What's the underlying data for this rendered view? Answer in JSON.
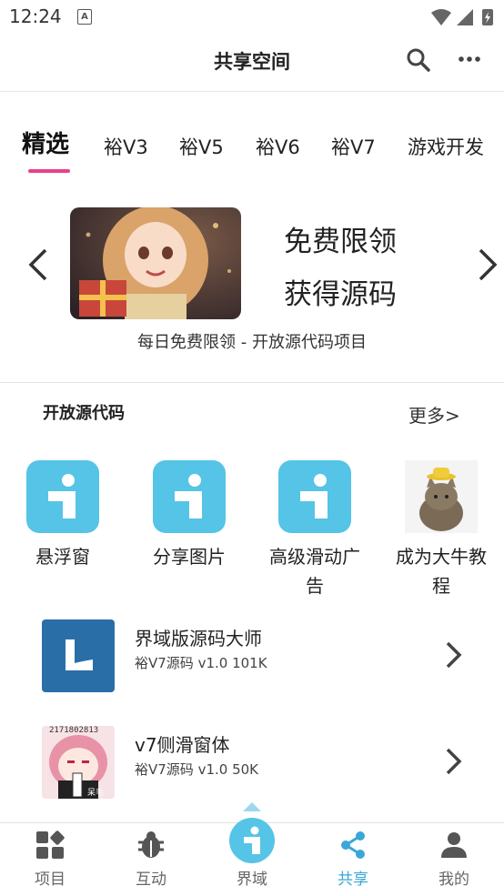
{
  "status_bar": {
    "time": "12:24",
    "notif_glyph": "A"
  },
  "header": {
    "title": "共享空间",
    "search_icon": "search-icon",
    "more_icon": "more-icon"
  },
  "tabs": [
    {
      "label": "精选",
      "active": true
    },
    {
      "label": "裕V3"
    },
    {
      "label": "裕V5"
    },
    {
      "label": "裕V6"
    },
    {
      "label": "裕V7"
    },
    {
      "label": "游戏开发"
    }
  ],
  "banner": {
    "line1": "免费限领",
    "line2": "获得源码",
    "caption": "每日免费限领 - 开放源代码项目"
  },
  "section": {
    "title": "开放源代码",
    "more": "更多>"
  },
  "grid": [
    {
      "label": "悬浮窗",
      "icon": "info-app-icon"
    },
    {
      "label": "分享图片",
      "icon": "info-app-icon"
    },
    {
      "label": "高级滑动广告",
      "icon": "info-app-icon"
    },
    {
      "label": "成为大牛教程",
      "icon": "cat-hat-image"
    }
  ],
  "list": [
    {
      "title": "界域版源码大师",
      "meta": "裕V7源码  v1.0  101K"
    },
    {
      "title": "v7侧滑窗体",
      "meta": "裕V7源码  v1.0  50K",
      "thumb_text": "2171802813",
      "thumb_tag": "呆毛"
    }
  ],
  "bottom_nav": [
    {
      "label": "项目",
      "icon": "grid-icon"
    },
    {
      "label": "互动",
      "icon": "bug-icon"
    },
    {
      "label": "界域",
      "icon": "info-center-icon"
    },
    {
      "label": "共享",
      "icon": "share-icon",
      "active": true
    },
    {
      "label": "我的",
      "icon": "person-icon"
    }
  ],
  "colors": {
    "accent": "#3aa7d8",
    "tab_indicator": "#e8408a",
    "icon_tile": "#55c4e6"
  }
}
